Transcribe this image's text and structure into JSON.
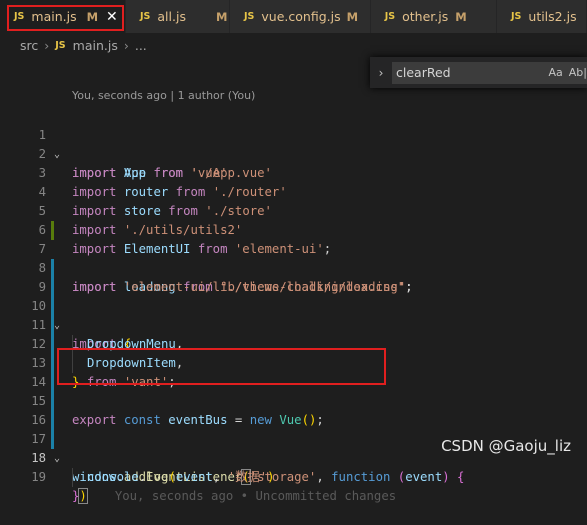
{
  "tabs": [
    {
      "icon": "JS",
      "name": "main.js",
      "status": "M",
      "close": "✕"
    },
    {
      "icon": "JS",
      "name": "all.js",
      "status": "M"
    },
    {
      "icon": "JS",
      "name": "vue.config.js",
      "status": "M"
    },
    {
      "icon": "JS",
      "name": "other.js",
      "status": "M"
    },
    {
      "icon": "JS",
      "name": "utils2.js"
    }
  ],
  "breadcrumb": {
    "folder": "src",
    "icon": "JS",
    "file": "main.js",
    "more": "..."
  },
  "find": {
    "value": "clearRed",
    "case_option": "Aa",
    "word_option": "Ab|"
  },
  "blame": {
    "text": "You, seconds ago | 1 author (You)"
  },
  "code": {
    "line_numbers": [
      "1",
      "2",
      "3",
      "4",
      "5",
      "6",
      "7",
      "8",
      "9",
      "10",
      "11",
      "12",
      "13",
      "14",
      "15",
      "16",
      "17",
      "18",
      "19"
    ],
    "l1": {
      "kw": "import",
      "id": "Vue",
      "from": "from",
      "str": "'vue'"
    },
    "l2": {
      "kw": "import",
      "id": "App",
      "from": "from",
      "str": "'./App.vue'"
    },
    "l3": {
      "kw": "import",
      "id": "router",
      "from": "from",
      "str": "'./router'"
    },
    "l4": {
      "kw": "import",
      "id": "store",
      "from": "from",
      "str": "'./store'"
    },
    "l5": {
      "kw": "import",
      "str": "'./utils/utils2'"
    },
    "l6": {
      "kw": "import",
      "id": "ElementUI",
      "from": "from",
      "str": "'element-ui'",
      "end": ";"
    },
    "l7": {
      "kw": "import",
      "id": "loadong",
      "from": "from",
      "str": "\"./views/loading/loading\"",
      "end": ";"
    },
    "l8": {
      "kw": "import",
      "str": "'element-ui/lib/theme-chalk/index.css'",
      "end": ";"
    },
    "l9": {
      "kw": "import",
      "brace": "{"
    },
    "l10": {
      "id": "DropdownMenu",
      "end": ","
    },
    "l11": {
      "id": "DropdownItem",
      "end": ","
    },
    "l12": {
      "brace": "}",
      "from": "from",
      "str": "'vant'",
      "end": ";"
    },
    "l14": {
      "kw1": "export",
      "kw2": "const",
      "id": "eventBus",
      "eq": "=",
      "kw3": "new",
      "cls": "Vue",
      "paren": "()",
      "end": ";"
    },
    "l16": {
      "id": "window",
      "dot": ".",
      "fn": "addEventListener",
      "open": "(",
      "str": "'storage'",
      "comma": ",",
      "kw": "function",
      "popen": "(",
      "param": "event",
      "pclose": ")",
      "brace": "{"
    },
    "l17": {
      "id": "console",
      "dot": ".",
      "fn": "log",
      "open": "(",
      "arg": "event",
      "comma": ",",
      "str": "'数据'",
      "close": ")"
    },
    "l18": {
      "brace": "}",
      "close": ")",
      "ghost": "You, seconds ago • Uncommitted changes"
    }
  },
  "watermark": "CSDN @Gaoju_liz",
  "colors": {
    "highlight_box": "#e01f1f",
    "background": "#1e1e1e"
  }
}
